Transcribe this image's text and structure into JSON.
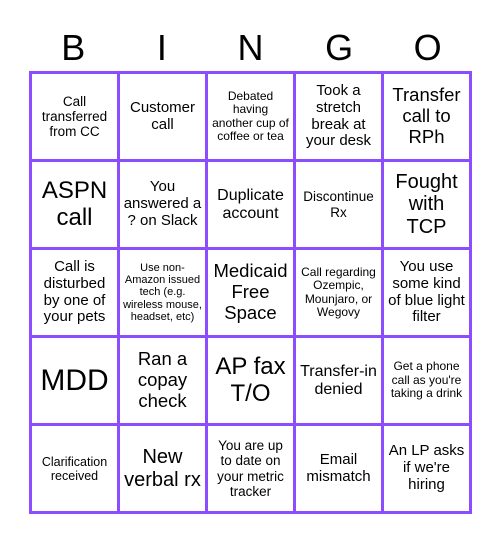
{
  "header": {
    "letters": [
      "B",
      "I",
      "N",
      "G",
      "O"
    ]
  },
  "board": {
    "border_color": "#8c4dff",
    "rows": [
      [
        "Call transferred from CC",
        "Customer call",
        "Debated having another cup of coffee or tea",
        "Took a stretch break at your desk",
        "Transfer call to RPh"
      ],
      [
        "ASPN call",
        "You answered a ? on Slack",
        "Duplicate account",
        "Discontinue Rx",
        "Fought with TCP"
      ],
      [
        "Call is disturbed by one of your pets",
        "Use non-Amazon issued tech (e.g. wireless mouse, headset, etc)",
        "Medicaid Free Space",
        "Call regarding Ozempic, Mounjaro, or Wegovy",
        "You use some kind of blue light filter"
      ],
      [
        "MDD",
        "Ran a copay check",
        "AP fax T/O",
        "Transfer-in denied",
        "Get a phone call as you're taking a drink"
      ],
      [
        "Clarification received",
        "New verbal rx",
        "You are up to date on your metric tracker",
        "Email mismatch",
        "An LP asks if we're hiring"
      ]
    ]
  }
}
